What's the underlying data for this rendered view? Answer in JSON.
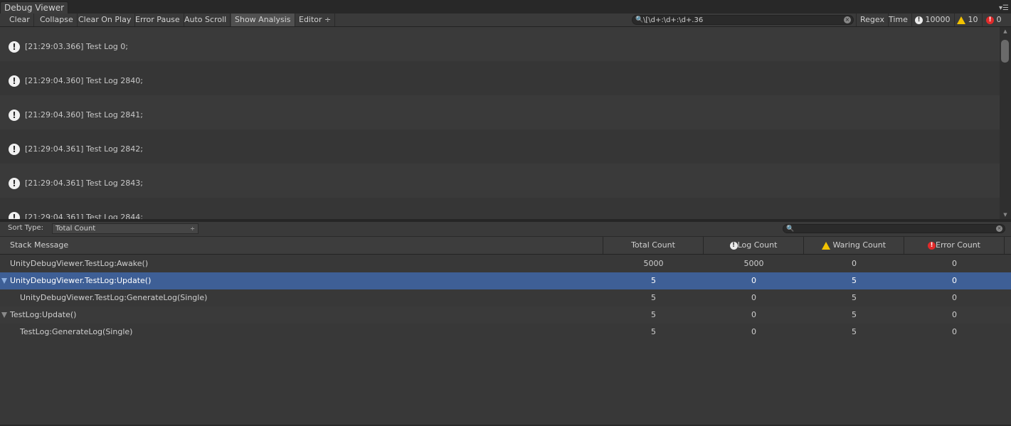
{
  "window": {
    "tab_title": "Debug Viewer",
    "menu_glyph": "▾☰"
  },
  "toolbar": {
    "buttons": [
      "Clear",
      "Collapse",
      "Clear On Play",
      "Error Pause",
      "Auto Scroll",
      "Show Analysis"
    ],
    "active_button": "Show Analysis",
    "editor_dropdown": "Editor ÷",
    "search_value": "\\[\\d+:\\d+:\\d+.36",
    "regex_label": "Regex",
    "time_label": "Time",
    "log_count": "10000",
    "warning_count": "10",
    "error_count": "0"
  },
  "log_entries": [
    "[21:29:03.366] Test Log 0;",
    "[21:29:04.360] Test Log 2840;",
    "[21:29:04.360] Test Log 2841;",
    "[21:29:04.361] Test Log 2842;",
    "[21:29:04.361] Test Log 2843;",
    "[21:29:04.361] Test Log 2844;"
  ],
  "analysis": {
    "sort_label": "Sort Type:",
    "sort_value": "Total Count",
    "sort_arrow": "÷",
    "columns": {
      "stack": "Stack Message",
      "total": "Total Count",
      "log": "Log Count",
      "warning": "Waring Count",
      "error": "Error Count"
    },
    "rows": [
      {
        "message": "UnityDebugViewer.TestLog:Awake()",
        "total": "5000",
        "log": "5000",
        "warning": "0",
        "error": "0",
        "expandable": false,
        "indent": false,
        "selected": false
      },
      {
        "message": "UnityDebugViewer.TestLog:Update()",
        "total": "5",
        "log": "0",
        "warning": "5",
        "error": "0",
        "expandable": true,
        "indent": false,
        "selected": true
      },
      {
        "message": "UnityDebugViewer.TestLog:GenerateLog(Single)",
        "total": "5",
        "log": "0",
        "warning": "5",
        "error": "0",
        "expandable": false,
        "indent": true,
        "selected": false
      },
      {
        "message": "TestLog:Update()",
        "total": "5",
        "log": "0",
        "warning": "5",
        "error": "0",
        "expandable": true,
        "indent": false,
        "selected": false
      },
      {
        "message": "TestLog:GenerateLog(Single)",
        "total": "5",
        "log": "0",
        "warning": "5",
        "error": "0",
        "expandable": false,
        "indent": true,
        "selected": false
      }
    ]
  },
  "icons": {
    "log": "!",
    "error": "!",
    "search": "🔍",
    "clear": "×"
  }
}
